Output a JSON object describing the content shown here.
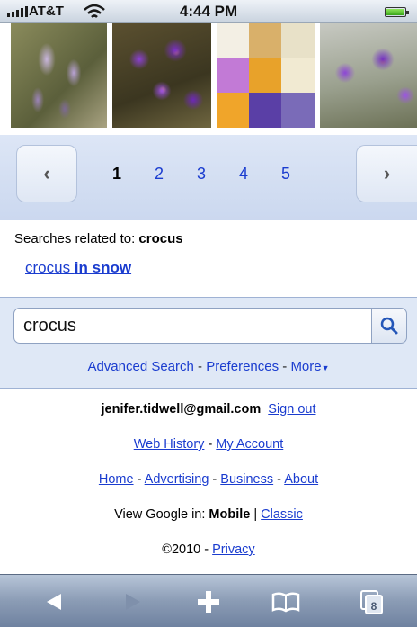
{
  "status_bar": {
    "carrier": "AT&T",
    "time": "4:44 PM",
    "battery_level": 1.0
  },
  "image_results": [
    {
      "icon": "crocus-photo-1"
    },
    {
      "icon": "crocus-photo-2"
    },
    {
      "icon": "crocus-photo-3"
    },
    {
      "icon": "crocus-photo-4"
    }
  ],
  "pager": {
    "prev_label": "‹",
    "next_label": "›",
    "pages": [
      "1",
      "2",
      "3",
      "4",
      "5"
    ],
    "current": "1"
  },
  "related": {
    "heading_prefix": "Searches related to: ",
    "heading_term": "crocus",
    "link_prefix": "crocus ",
    "link_bold": "in snow"
  },
  "search": {
    "query": "crocus",
    "advanced_label": "Advanced Search",
    "preferences_label": "Preferences",
    "more_label": "More",
    "separator": " - "
  },
  "footer": {
    "email": "jenifer.tidwell@gmail.com",
    "sign_out": "Sign out",
    "web_history": "Web History",
    "my_account": "My Account",
    "home": "Home",
    "advertising": "Advertising",
    "business": "Business",
    "about": "About",
    "view_in_prefix": "View Google in: ",
    "mobile": "Mobile",
    "pipe": " | ",
    "classic": "Classic",
    "copyright": "©2010",
    "privacy": "Privacy",
    "separator": " - "
  },
  "toolbar": {
    "icons": [
      "back-icon",
      "forward-icon",
      "add-icon",
      "bookmarks-icon",
      "pages-icon"
    ],
    "pages_count": "8"
  },
  "colors": {
    "link": "#1a3ccf",
    "band": "#dfe8f6",
    "toolbar": "#8b9cb5"
  }
}
